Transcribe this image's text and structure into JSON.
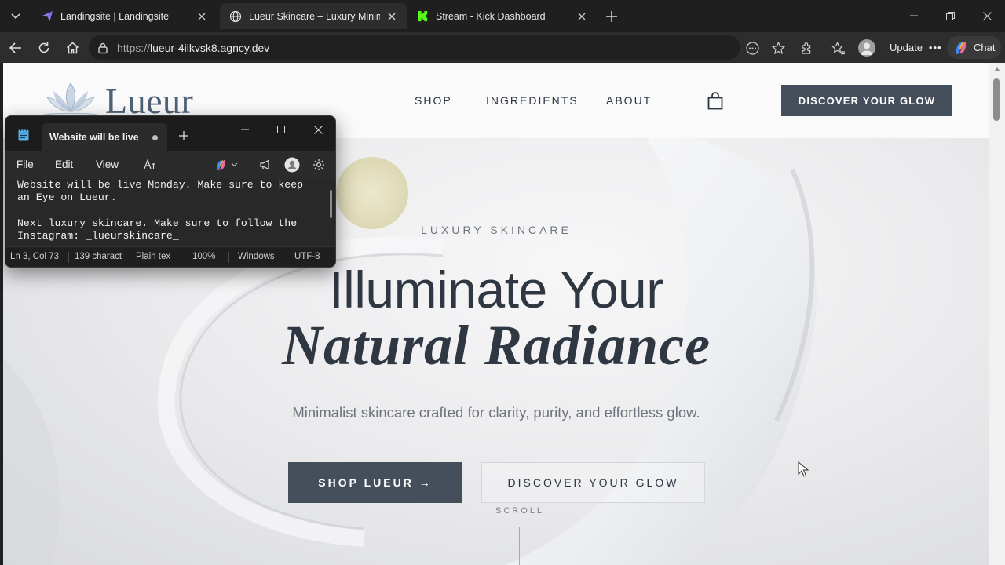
{
  "browser": {
    "tabs": [
      {
        "title": "Landingsite | Landingsite",
        "icon": "paper-plane-icon",
        "active": false
      },
      {
        "title": "Lueur Skincare – Luxury Minimalist",
        "icon": "globe-icon",
        "active": true
      },
      {
        "title": "Stream - Kick Dashboard",
        "icon": "kick-logo-icon",
        "active": false
      }
    ],
    "url_prefix": "https://",
    "url_host": "lueur-4ilkvsk8.agncy.dev",
    "update_label": "Update",
    "chat_label": "Chat"
  },
  "site": {
    "logo_text": "Lueur",
    "nav": [
      "SHOP",
      "INGREDIENTS",
      "ABOUT"
    ],
    "header_cta": "DISCOVER YOUR GLOW",
    "hero": {
      "eyebrow": "LUXURY SKINCARE",
      "headline_line1": "Illuminate Your",
      "headline_line2": "Natural Radiance",
      "subline": "Minimalist skincare crafted for clarity, purity, and effortless glow.",
      "primary_button": "SHOP LUEUR →",
      "secondary_button": "DISCOVER YOUR GLOW",
      "scroll_label": "SCROLL"
    },
    "colors": {
      "accent_dark": "#454f5c",
      "logo": "#4e6277",
      "text": "#2f3742"
    }
  },
  "notepad": {
    "tab_title": "Website will be live",
    "menu": [
      "File",
      "Edit",
      "View"
    ],
    "lines": [
      "Website will be live Monday. Make sure to keep",
      "an Eye on Lueur.",
      "",
      "Next luxury skincare. Make sure to follow the",
      "Instagram: _lueurskincare_"
    ],
    "status": {
      "position": "Ln 3, Col 73",
      "chars": "139 charact",
      "format": "Plain tex",
      "zoom": "100%",
      "line_ending": "Windows",
      "encoding": "UTF-8"
    }
  }
}
